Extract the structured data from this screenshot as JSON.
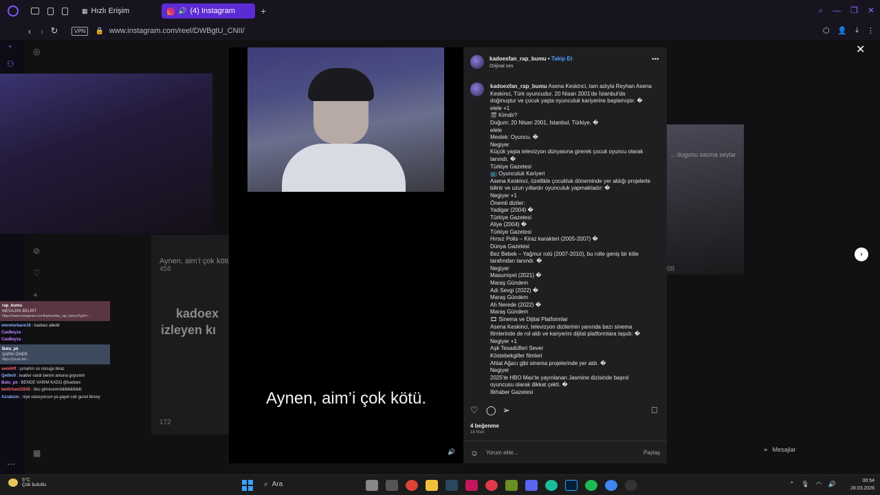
{
  "browser": {
    "tabs": [
      {
        "label": "Hızlı Erişim"
      },
      {
        "label": "(4) Instagram"
      }
    ],
    "vpn_label": "VPN",
    "url": "www.instagram.com/reel/DWBgtU_CNII/"
  },
  "background": {
    "left_caption": "Aynen, aim’i çok kötü",
    "left_views": "456",
    "card_text_1": "kadoex",
    "card_text_2": "izleyen kı",
    "card_views": "172",
    "right_text": "... dugunu sacma seylar",
    "right_views": "08"
  },
  "chat": {
    "messages": [
      {
        "user": "rap_bumu",
        "text": "MESAJINI BELİRT",
        "extra": "https://www.instagram.com/kadoexfan_rap_bumu?igsh=...",
        "highlight": true
      },
      {
        "user": "emreturkann16",
        "text": ": kadoex alledir"
      },
      {
        "user": "CasBeyza",
        "text": ":"
      },
      {
        "user": "CasBeyza",
        "text": ":"
      },
      {
        "user": "Batu_pk",
        "text": "ŞARKI ÖNER",
        "extra": "https://youtu.be/...",
        "highlight2": true
      },
      {
        "user": "semihff",
        "text": ": şımartın su cocugu biraz"
      },
      {
        "user": "Qetfer0",
        "text": ": leakler vardı benim amuna goyumm"
      },
      {
        "user": "Batu_pk",
        "text": ": BENDE VARIM KADO @kadoex"
      },
      {
        "user": "bedirhan23242",
        "text": ": tlou girmicenmiiiiiiiiiiiiiiiiiiiiiii"
      },
      {
        "user": "Azrabulu",
        "text": ": niye utanıyorsun ya gayet cok guzel birsey"
      }
    ]
  },
  "reel": {
    "caption": "Aynen, aim’i çok kötü."
  },
  "post": {
    "username": "kadoexfan_rap_bumu",
    "follow_label": "Takip Et",
    "audio": "Orijinal ses",
    "description_lines": [
      "Asena Keskinci, tam adıyla Reyhan Asena",
      "Keskinci, Türk oyuncudur. 20 Nisan 2001'de İstanbul'da",
      "doğmuştur ve çocuk yaşta oyunculuk kariyerine başlamıştır. �",
      "elele +1",
      "🎬 Kimdir?",
      "Doğum: 20 Nisan 2001, İstanbul, Türkiye. �",
      "elele",
      "Meslek: Oyuncu. �",
      "Negiyer",
      "Küçük yaşta televizyon dünyasına girerek çocuk oyuncu olarak",
      "tanındı. �",
      "Türkiye Gazetesi",
      "📺 Oyunculuk Kariyeri",
      "Asena Keskinci, özellikle çocukluk döneminde yer aldığı projelerle",
      "bilinir ve uzun yıllardır oyunculuk yapmaktadır: �",
      "Negiyer +1",
      "Önemli diziler:",
      "Yadigar (2004) �",
      "Türkiye Gazetesi",
      "Aliye (2004) �",
      "Türkiye Gazetesi",
      "Hırsız Polis – Kiraz karakteri (2005-2007) �",
      "Dünya Gazetesi",
      "Bez Bebek – Yağmur rolü (2007-2010), bu rolle geniş bir kitle",
      "tarafından tanındı. �",
      "Negiyer",
      "Masumiyet (2021) �",
      "Maraş Gündem",
      "Adı Sevgi (2022) �",
      "Maraş Gündem",
      "Ah Nerede (2022) �",
      "Maraş Gündem",
      "🎞 Sinema ve Dijital Platformlar",
      "Asena Keskinci, televizyon dizilerinin yanında bazı sinema",
      "filmlerinde de rol aldı ve kariyerini dijital platformlara taşıdı: �",
      "Negiyer +1",
      "Aşk Tesadüfleri Sever",
      "Köstebekgiller filmleri",
      "Ahlat Ağacı gibi sinema projelerinde yer aldı. �",
      "Negiyer",
      "2025'te HBO Max'te yayınlanan Jasmine dizisinde başrol",
      "oyuncusu olarak dikkat çekti. �",
      "İlkhaber Gazetesi"
    ],
    "likes": "4 beğenme",
    "date": "18 Mart",
    "comment_placeholder": "Yorum ekle...",
    "share_label": "Paylaş"
  },
  "overlay": {
    "messages_label": "Mesajlar"
  },
  "taskbar": {
    "temperature": "5°C",
    "weather": "Çok bulutlu",
    "search_label": "Ara",
    "time": "00:54",
    "date": "28.03.2026"
  }
}
